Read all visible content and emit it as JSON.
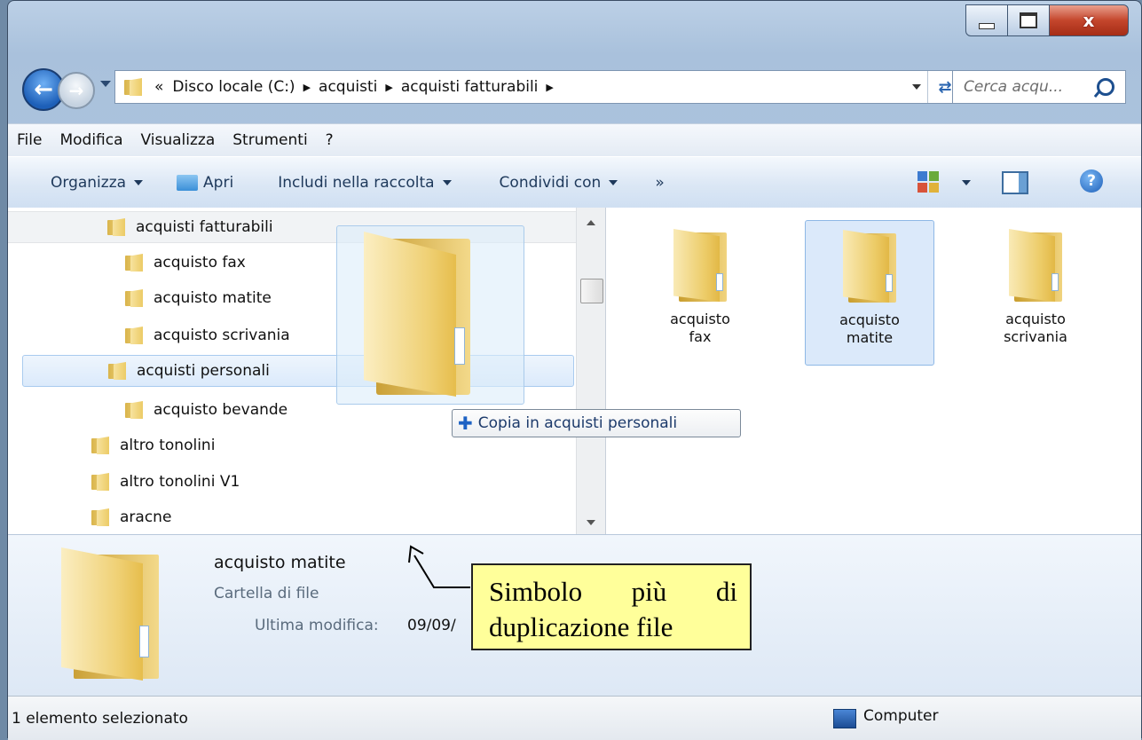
{
  "window": {
    "controls": {
      "minimize": "minimize",
      "maximize": "maximize",
      "close": "x"
    }
  },
  "address": {
    "overflow": "«",
    "crumbs": [
      "Disco locale (C:)",
      "acquisti",
      "acquisti fatturabili"
    ],
    "search_placeholder": "Cerca acqu..."
  },
  "menu": [
    "File",
    "Modifica",
    "Visualizza",
    "Strumenti",
    "?"
  ],
  "toolbar": {
    "organize": "Organizza",
    "open": "Apri",
    "include": "Includi nella raccolta",
    "share": "Condividi con",
    "more": "»"
  },
  "tree": [
    {
      "label": "acquisti fatturabili"
    },
    {
      "label": "acquisto fax"
    },
    {
      "label": "acquisto matite"
    },
    {
      "label": "acquisto scrivania"
    },
    {
      "label": "acquisti personali"
    },
    {
      "label": "acquisto bevande"
    },
    {
      "label": "altro tonolini"
    },
    {
      "label": "altro tonolini V1"
    },
    {
      "label": "aracne"
    }
  ],
  "files": [
    {
      "line1": "acquisto",
      "line2": "fax"
    },
    {
      "line1": "acquisto",
      "line2": "matite"
    },
    {
      "line1": "acquisto",
      "line2": "scrivania"
    }
  ],
  "drag_tooltip": "Copia in acquisti personali",
  "details": {
    "name": "acquisto matite",
    "type": "Cartella di file",
    "modified_label": "Ultima modifica:",
    "modified_value": "09/09/"
  },
  "callout": {
    "words": [
      "Simbolo",
      "più",
      "di"
    ],
    "line2": "duplicazione file"
  },
  "status": {
    "selection": "1 elemento selezionato",
    "location": "Computer"
  },
  "colors": {
    "accent": "#1d62c4",
    "callout_bg": "#ffff9a",
    "selection": "#dbe9fa"
  }
}
